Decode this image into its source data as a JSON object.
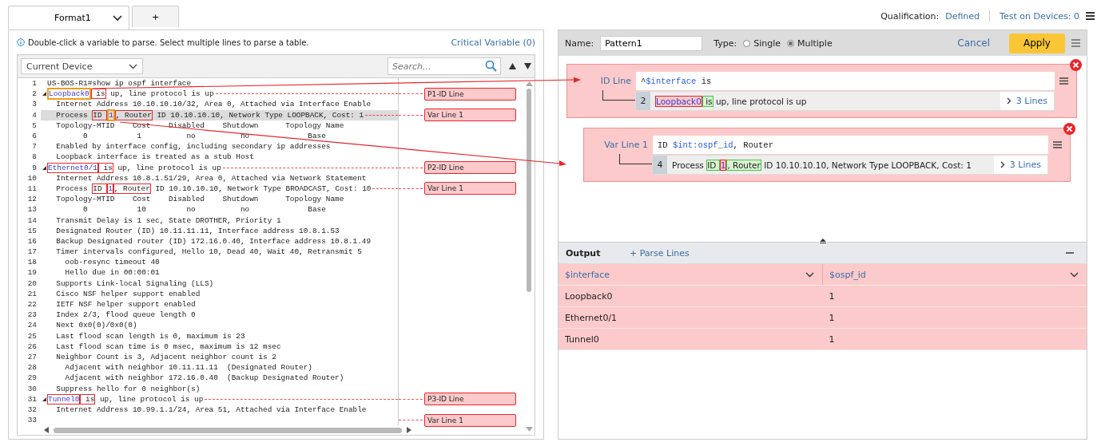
{
  "tabs": [
    {
      "label": "Format1",
      "selected": true,
      "has_menu": true
    },
    {
      "label": "+",
      "selected": false,
      "has_menu": false
    }
  ],
  "header": {
    "qualification_label": "Qualification:",
    "qualification_value": "Defined",
    "test_link": "Test on Devices: 0"
  },
  "left_panel": {
    "hint": "Double-click a variable to parse. Select multiple lines to parse a table.",
    "critical_link": "Critical Variable (0)",
    "device_select": "Current Device",
    "search": {
      "placeholder": "Search..."
    },
    "lines": [
      {
        "num": "1",
        "selected": false,
        "expandable": false,
        "segments": [
          {
            "text": "US-BOS-R1#show ip ospf interface",
            "kind": "text"
          }
        ]
      },
      {
        "num": "2",
        "selected": false,
        "expandable": true,
        "tag": "P1-ID Line",
        "segments": [
          {
            "text": "Loopback0",
            "kind": "var-picked"
          },
          {
            "text": " is",
            "kind": "anchor"
          },
          {
            "text": " up, line protocol is up",
            "kind": "text"
          }
        ]
      },
      {
        "num": "3",
        "selected": false,
        "expandable": false,
        "segments": [
          {
            "text": "  Internet Address 10.10.10.10/32, Area 0, Attached via Interface Enable",
            "kind": "text"
          }
        ]
      },
      {
        "num": "4",
        "selected": true,
        "expandable": false,
        "tag": "Var Line 1",
        "segments": [
          {
            "text": "  Process ",
            "kind": "text"
          },
          {
            "text": "ID ",
            "kind": "anchor"
          },
          {
            "text": "1",
            "kind": "var-picked"
          },
          {
            "text": ", Router",
            "kind": "anchor"
          },
          {
            "text": " ID 10.10.10.10, Network Type LOOPBACK, Cost: 1",
            "kind": "text"
          }
        ]
      },
      {
        "num": "5",
        "selected": false,
        "expandable": false,
        "segments": [
          {
            "text": "  Topology-MTID    Cost    Disabled    Shutdown      Topology Name",
            "kind": "text"
          }
        ]
      },
      {
        "num": "6",
        "selected": false,
        "expandable": false,
        "segments": [
          {
            "text": "        0           1          no          no             Base",
            "kind": "text"
          }
        ]
      },
      {
        "num": "7",
        "selected": false,
        "expandable": false,
        "segments": [
          {
            "text": "  Enabled by interface config, including secondary ip addresses",
            "kind": "text"
          }
        ]
      },
      {
        "num": "8",
        "selected": false,
        "expandable": false,
        "segments": [
          {
            "text": "  Loopback interface is treated as a stub Host",
            "kind": "text"
          }
        ]
      },
      {
        "num": "9",
        "selected": false,
        "expandable": true,
        "tag": "P2-ID Line",
        "segments": [
          {
            "text": "Ethernet0/1",
            "kind": "var"
          },
          {
            "text": " is",
            "kind": "anchor"
          },
          {
            "text": " up, line protocol is up",
            "kind": "text"
          }
        ]
      },
      {
        "num": "10",
        "selected": false,
        "expandable": false,
        "segments": [
          {
            "text": "  Internet Address 10.8.1.51/29, Area 0, Attached via Network Statement",
            "kind": "text"
          }
        ]
      },
      {
        "num": "11",
        "selected": false,
        "expandable": false,
        "tag": "Var Line 1",
        "segments": [
          {
            "text": "  Process ",
            "kind": "text"
          },
          {
            "text": "ID ",
            "kind": "anchor"
          },
          {
            "text": "1",
            "kind": "var"
          },
          {
            "text": ", Router",
            "kind": "anchor"
          },
          {
            "text": " ID 10.10.10.10, Network Type BROADCAST, Cost: 10",
            "kind": "text"
          }
        ]
      },
      {
        "num": "12",
        "selected": false,
        "expandable": false,
        "segments": [
          {
            "text": "  Topology-MTID    Cost    Disabled    Shutdown      Topology Name",
            "kind": "text"
          }
        ]
      },
      {
        "num": "13",
        "selected": false,
        "expandable": false,
        "segments": [
          {
            "text": "        0           10         no          no             Base",
            "kind": "text"
          }
        ]
      },
      {
        "num": "14",
        "selected": false,
        "expandable": false,
        "segments": [
          {
            "text": "  Transmit Delay is 1 sec, State DROTHER, Priority 1",
            "kind": "text"
          }
        ]
      },
      {
        "num": "15",
        "selected": false,
        "expandable": false,
        "segments": [
          {
            "text": "  Designated Router (ID) 10.11.11.11, Interface address 10.8.1.53",
            "kind": "text"
          }
        ]
      },
      {
        "num": "16",
        "selected": false,
        "expandable": false,
        "segments": [
          {
            "text": "  Backup Designated router (ID) 172.16.0.40, Interface address 10.8.1.49",
            "kind": "text"
          }
        ]
      },
      {
        "num": "17",
        "selected": false,
        "expandable": false,
        "segments": [
          {
            "text": "  Timer intervals configured, Hello 10, Dead 40, Wait 40, Retransmit 5",
            "kind": "text"
          }
        ]
      },
      {
        "num": "18",
        "selected": false,
        "expandable": false,
        "segments": [
          {
            "text": "    oob-resync timeout 40",
            "kind": "text"
          }
        ]
      },
      {
        "num": "19",
        "selected": false,
        "expandable": false,
        "segments": [
          {
            "text": "    Hello due in 00:00:01",
            "kind": "text"
          }
        ]
      },
      {
        "num": "20",
        "selected": false,
        "expandable": false,
        "segments": [
          {
            "text": "  Supports Link-local Signaling (LLS)",
            "kind": "text"
          }
        ]
      },
      {
        "num": "21",
        "selected": false,
        "expandable": false,
        "segments": [
          {
            "text": "  Cisco NSF helper support enabled",
            "kind": "text"
          }
        ]
      },
      {
        "num": "22",
        "selected": false,
        "expandable": false,
        "segments": [
          {
            "text": "  IETF NSF helper support enabled",
            "kind": "text"
          }
        ]
      },
      {
        "num": "23",
        "selected": false,
        "expandable": false,
        "segments": [
          {
            "text": "  Index 2/3, flood queue length 0",
            "kind": "text"
          }
        ]
      },
      {
        "num": "24",
        "selected": false,
        "expandable": false,
        "segments": [
          {
            "text": "  Next 0x0(0)/0x0(0)",
            "kind": "text"
          }
        ]
      },
      {
        "num": "25",
        "selected": false,
        "expandable": false,
        "segments": [
          {
            "text": "  Last flood scan length is 0, maximum is 23",
            "kind": "text"
          }
        ]
      },
      {
        "num": "26",
        "selected": false,
        "expandable": false,
        "segments": [
          {
            "text": "  Last flood scan time is 0 msec, maximum is 12 msec",
            "kind": "text"
          }
        ]
      },
      {
        "num": "27",
        "selected": false,
        "expandable": false,
        "segments": [
          {
            "text": "  Neighbor Count is 3, Adjacent neighbor count is 2",
            "kind": "text"
          }
        ]
      },
      {
        "num": "28",
        "selected": false,
        "expandable": false,
        "segments": [
          {
            "text": "    Adjacent with neighbor 10.11.11.11  (Designated Router)",
            "kind": "text"
          }
        ]
      },
      {
        "num": "29",
        "selected": false,
        "expandable": false,
        "segments": [
          {
            "text": "    Adjacent with neighbor 172.16.0.40  (Backup Designated Router)",
            "kind": "text"
          }
        ]
      },
      {
        "num": "30",
        "selected": false,
        "expandable": false,
        "segments": [
          {
            "text": "  Suppress hello for 0 neighbor(s)",
            "kind": "text"
          }
        ]
      },
      {
        "num": "31",
        "selected": false,
        "expandable": true,
        "tag": "P3-ID Line",
        "segments": [
          {
            "text": "Tunnel0",
            "kind": "var"
          },
          {
            "text": " is",
            "kind": "anchor"
          },
          {
            "text": " up, line protocol is up",
            "kind": "text"
          }
        ]
      },
      {
        "num": "32",
        "selected": false,
        "expandable": false,
        "segments": [
          {
            "text": "  Internet Address 10.99.1.1/24, Area 51, Attached via Interface Enable",
            "kind": "text"
          }
        ]
      },
      {
        "num": "33",
        "tag": "Var Line 1"
      }
    ]
  },
  "pattern_editor": {
    "name_label": "Name:",
    "name_value": "Pattern1",
    "type_label": "Type:",
    "type_options": [
      {
        "label": "Single",
        "selected": false
      },
      {
        "label": "Multiple",
        "selected": true
      }
    ],
    "cancel": "Cancel",
    "apply": "Apply",
    "patterns": [
      {
        "kind": "id",
        "label": "ID Line",
        "expression": [
          {
            "text": "^",
            "kind": "text"
          },
          {
            "text": "$interface",
            "kind": "var"
          },
          {
            "text": " is",
            "kind": "text"
          }
        ],
        "sample": {
          "num": "2",
          "segments": [
            {
              "text": "Loopback0",
              "kind": "var"
            },
            {
              "text": " is",
              "kind": "anchor"
            },
            {
              "text": " up, line protocol is up",
              "kind": "text"
            }
          ],
          "more": "3 Lines"
        }
      },
      {
        "kind": "var",
        "label": "Var Line 1",
        "expression": [
          {
            "text": "ID ",
            "kind": "text"
          },
          {
            "text": "$int:ospf_id",
            "kind": "var"
          },
          {
            "text": ", Router",
            "kind": "text"
          }
        ],
        "sample": {
          "num": "4",
          "segments": [
            {
              "text": "Process ",
              "kind": "text"
            },
            {
              "text": "ID ",
              "kind": "anchor"
            },
            {
              "text": "1",
              "kind": "var"
            },
            {
              "text": ", Router",
              "kind": "anchor"
            },
            {
              "text": " ID 10.10.10.10, Network Type LOOPBACK, Cost: 1",
              "kind": "text"
            }
          ],
          "more": "3 Lines"
        }
      }
    ]
  },
  "output": {
    "title": "Output",
    "parse_link": "+ Parse Lines",
    "table": {
      "columns": [
        "$interface",
        "$ospf_id"
      ],
      "rows": [
        [
          "Loopback0",
          "1"
        ],
        [
          "Ethernet0/1",
          "1"
        ],
        [
          "Tunnel0",
          "1"
        ]
      ]
    }
  }
}
